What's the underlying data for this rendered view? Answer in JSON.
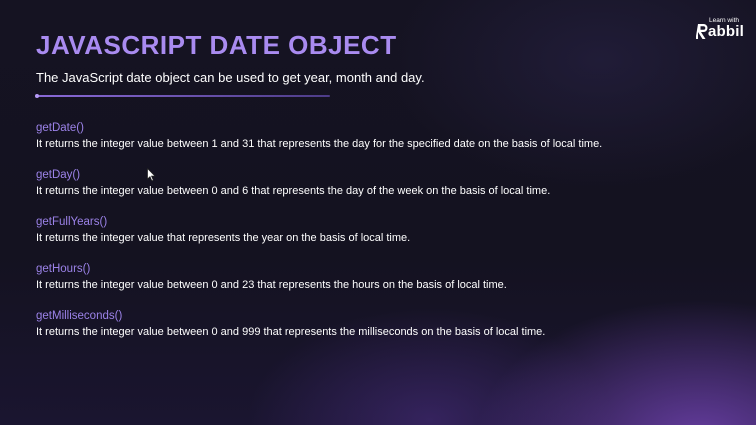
{
  "slide": {
    "title": "JAVASCRIPT DATE OBJECT",
    "subtitle": "The JavaScript date object can be used to get year, month and day."
  },
  "logo": {
    "tagline": "Learn with",
    "wordmark": "abbil"
  },
  "methods": [
    {
      "name": "getDate()",
      "description": "It returns the integer value between 1 and 31 that represents the day for the specified date on the basis of local time."
    },
    {
      "name": "getDay()",
      "description": "It returns the integer value between 0 and 6 that represents the day of the week on the basis of local time."
    },
    {
      "name": "getFullYears()",
      "description": "It returns the integer value that represents the year on the basis of local time."
    },
    {
      "name": "getHours()",
      "description": "It returns the integer value between 0 and 23 that represents the hours on the basis of local time."
    },
    {
      "name": "getMilliseconds()",
      "description": "It returns the integer value between 0 and 999 that represents the milliseconds on the basis of local time."
    }
  ],
  "colors": {
    "title": "#a98bf0",
    "method_name": "#9b82e8",
    "background": "#151322",
    "glow": "#7e4ac4"
  },
  "icons": {
    "logo": "rabbil-r-logo-icon",
    "cursor": "mouse-pointer-icon"
  }
}
